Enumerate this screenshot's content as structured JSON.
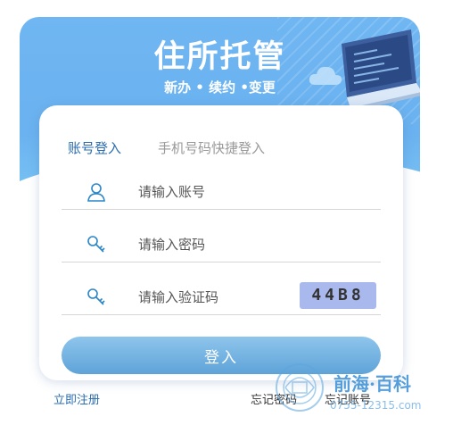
{
  "banner": {
    "title": "住所托管",
    "subtitle": "新办 • 续约 •变更"
  },
  "tabs": {
    "account": "账号登入",
    "phone": "手机号码快捷登入"
  },
  "form": {
    "account_placeholder": "请输入账号",
    "password_placeholder": "请输入密码",
    "captcha_placeholder": "请输入验证码",
    "captcha_code": "44B8",
    "login_label": "登入"
  },
  "links": {
    "register": "立即注册",
    "forgot_password": "忘记密码",
    "forgot_account": "忘记账号"
  },
  "watermark": {
    "title": "前海·百科",
    "phone": "0755-12315.com"
  },
  "colors": {
    "accent": "#2a6db0",
    "banner": "#6fb6f2",
    "captcha_bg": "#a9b9ee"
  }
}
